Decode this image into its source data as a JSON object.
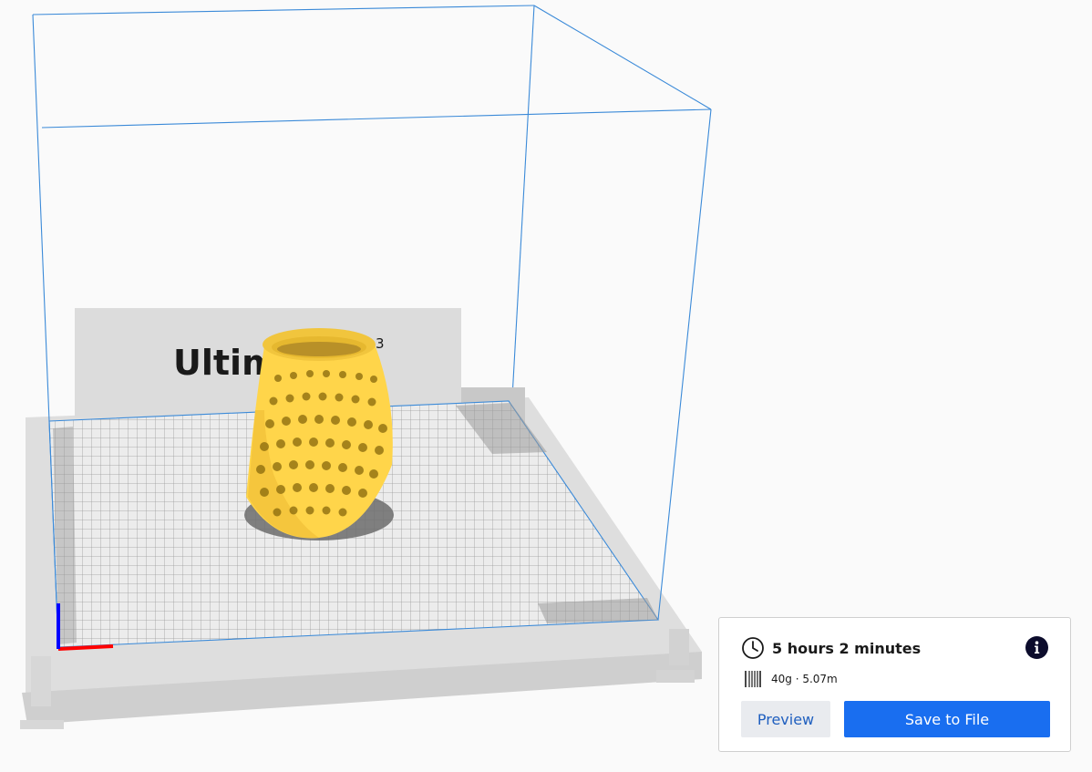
{
  "viewport": {
    "printer_logo": {
      "text": "Ultim",
      "superscript": "3"
    },
    "background_color": "#fafafa",
    "build_volume_color": "#3b8ad8",
    "model_color": "#ffd54a",
    "axis_colors": {
      "x": "#ff0000",
      "y": "#0000ff"
    }
  },
  "job_panel": {
    "print_time": "5 hours 2 minutes",
    "material_usage": "40g · 5.07m",
    "icons": {
      "time": "clock-icon",
      "material": "spool-icon",
      "info": "info-icon"
    },
    "preview_label": "Preview",
    "save_label": "Save to File",
    "colors": {
      "save_button": "#196ef0",
      "preview_button": "#e9ebef",
      "preview_text": "#1f5fbf"
    }
  }
}
